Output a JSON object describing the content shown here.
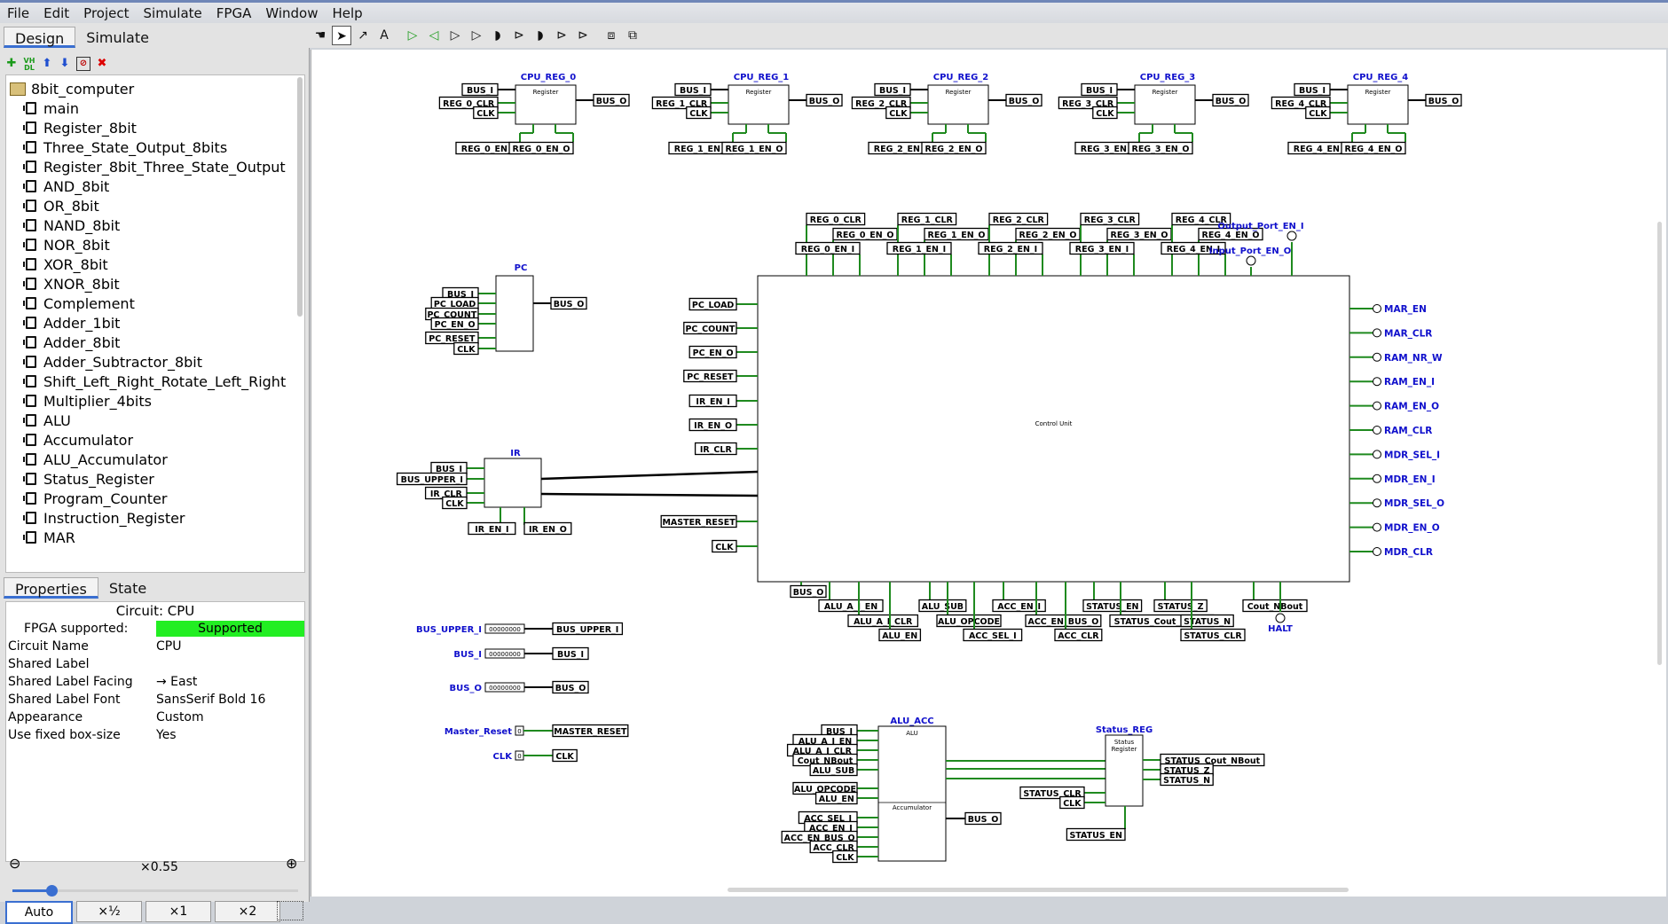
{
  "menu": [
    "File",
    "Edit",
    "Project",
    "Simulate",
    "FPGA",
    "Window",
    "Help"
  ],
  "left_tabs": {
    "design": "Design",
    "simulate": "Simulate"
  },
  "tree": {
    "root": "8bit_computer",
    "items": [
      "main",
      "Register_8bit",
      "Three_State_Output_8bits",
      "Register_8bit_Three_State_Output",
      "AND_8bit",
      "OR_8bit",
      "NAND_8bit",
      "NOR_8bit",
      "XOR_8bit",
      "XNOR_8bit",
      "Complement",
      "Adder_1bit",
      "Adder_8bit",
      "Adder_Subtractor_8bit",
      "Shift_Left_Right_Rotate_Left_Right",
      "Multiplier_4bits",
      "ALU",
      "Accumulator",
      "ALU_Accumulator",
      "Status_Register",
      "Program_Counter",
      "Instruction_Register",
      "MAR"
    ]
  },
  "bottom_tabs": {
    "properties": "Properties",
    "state": "State"
  },
  "properties": {
    "title": "Circuit: CPU",
    "rows": [
      {
        "k": "FPGA supported:",
        "v": "Supported"
      },
      {
        "k": "Circuit Name",
        "v": "CPU"
      },
      {
        "k": "Shared Label",
        "v": ""
      },
      {
        "k": "Shared Label Facing",
        "v": "→ East"
      },
      {
        "k": "Shared Label Font",
        "v": "SansSerif Bold 16"
      },
      {
        "k": "Appearance",
        "v": "Custom"
      },
      {
        "k": "Use fixed box-size",
        "v": "Yes"
      }
    ]
  },
  "zoom": {
    "level": "×0.55",
    "buttons": [
      "Auto",
      "×½",
      "×1",
      "×2"
    ]
  },
  "toolbar_icons": [
    "hand-icon",
    "pointer-icon",
    "wire-icon",
    "text-icon",
    "input-pin-icon",
    "output-pin-icon",
    "not-gate-icon",
    "buffer-icon",
    "and-gate-icon",
    "or-gate-icon",
    "nand-gate-icon",
    "nor-gate-icon",
    "xor-gate-icon",
    "subcircuit-icon",
    "appearance-icon"
  ],
  "colors": {
    "wire": "#1f8a1f",
    "label": "#1010cc",
    "fpga_ok": "#22ee22"
  },
  "circuit": {
    "registers": [
      {
        "name": "CPU_REG_0",
        "clr": "REG_0_CLR",
        "en_i": "REG_0_EN_I",
        "en_o": "REG_0_EN_O"
      },
      {
        "name": "CPU_REG_1",
        "clr": "REG_1_CLR",
        "en_i": "REG_1_EN_I",
        "en_o": "REG_1_EN_O"
      },
      {
        "name": "CPU_REG_2",
        "clr": "REG_2_CLR",
        "en_i": "REG_2_EN_I",
        "en_o": "REG_2_EN_O"
      },
      {
        "name": "CPU_REG_3",
        "clr": "REG_3_CLR",
        "en_i": "REG_3_EN_I",
        "en_o": "REG_3_EN_O"
      },
      {
        "name": "CPU_REG_4",
        "clr": "REG_4_CLR",
        "en_i": "REG_4_EN_I",
        "en_o": "REG_4_EN_O"
      }
    ],
    "register_text": "Register",
    "bus_i": "BUS_I",
    "bus_o": "BUS_O",
    "clk": "CLK",
    "bus_upper_i": "BUS_UPPER_I",
    "control_unit": "Control Unit",
    "cu_top_labels": [
      "REG_0_CLR",
      "REG_0_EN_O",
      "REG_0_EN_I",
      "REG_1_CLR",
      "REG_1_EN_O",
      "REG_1_EN_I",
      "REG_2_CLR",
      "REG_2_EN_O",
      "REG_2_EN_I",
      "REG_3_CLR",
      "REG_3_EN_O",
      "REG_3_EN_I",
      "REG_4_CLR",
      "REG_4_EN_O",
      "REG_4_EN_I"
    ],
    "output_port_en_i": "Output_Port_EN_I",
    "input_port_en_o": "Input_Port_EN_O",
    "cu_left": [
      "PC_LOAD",
      "PC_COUNT",
      "PC_EN_O",
      "PC_RESET",
      "IR_EN_I",
      "IR_EN_O",
      "IR_CLR",
      "MASTER_RESET",
      "CLK"
    ],
    "cu_right": [
      "MAR_EN",
      "MAR_CLR",
      "RAM_NR_W",
      "RAM_EN_I",
      "RAM_EN_O",
      "RAM_CLR",
      "MDR_SEL_I",
      "MDR_EN_I",
      "MDR_SEL_O",
      "MDR_EN_O",
      "MDR_CLR"
    ],
    "cu_bottom": [
      "BUS_O",
      "ALU_A_I_EN",
      "ALU_A_I_CLR",
      "ALU_EN",
      "ALU_SUB",
      "ALU_OPCODE",
      "ACC_SEL_I",
      "ACC_EN_I",
      "ACC_EN_BUS_O",
      "ACC_CLR",
      "STATUS_EN",
      "STATUS_Cout_NBout",
      "STATUS_Z",
      "STATUS_N",
      "STATUS_CLR",
      "Cout_NBout"
    ],
    "halt": "HALT",
    "pc": {
      "name": "PC",
      "labels": [
        "BUS_I",
        "PC_LOAD",
        "PC_COUNT",
        "PC_EN_O",
        "PC_RESET",
        "CLK"
      ]
    },
    "ir": {
      "name": "IR",
      "labels": [
        "BUS_I",
        "BUS_UPPER_I",
        "IR_CLR",
        "CLK"
      ],
      "en_i": "IR_EN_I",
      "en_o": "IR_EN_O"
    },
    "inputs": [
      {
        "label": "BUS_UPPER_I",
        "value": "00000000",
        "tunnel": "BUS_UPPER_I"
      },
      {
        "label": "BUS_I",
        "value": "00000000",
        "tunnel": "BUS_I"
      },
      {
        "label": "BUS_O",
        "value": "00000000",
        "tunnel": "BUS_O"
      },
      {
        "label": "Master_Reset",
        "value": "0",
        "tunnel": "MASTER_RESET"
      },
      {
        "label": "CLK",
        "value": "0",
        "tunnel": "CLK"
      }
    ],
    "alu_acc": {
      "name": "ALU_ACC",
      "alu": "ALU",
      "acc": "Accumulator",
      "left": [
        "BUS_I",
        "ALU_A_I_EN",
        "ALU_A_I_CLR",
        "Cout_NBout",
        "ALU_SUB",
        "ALU_OPCODE",
        "ALU_EN",
        "ACC_SEL_I",
        "ACC_EN_I",
        "ACC_EN_BUS_O",
        "ACC_CLR",
        "CLK"
      ],
      "out": "BUS_O"
    },
    "status": {
      "name": "Status_REG",
      "text": "Status Register",
      "right": [
        "STATUS_Cout_NBout",
        "STATUS_Z",
        "STATUS_N"
      ],
      "left": [
        "STATUS_CLR",
        "CLK"
      ],
      "en": "STATUS_EN"
    }
  }
}
